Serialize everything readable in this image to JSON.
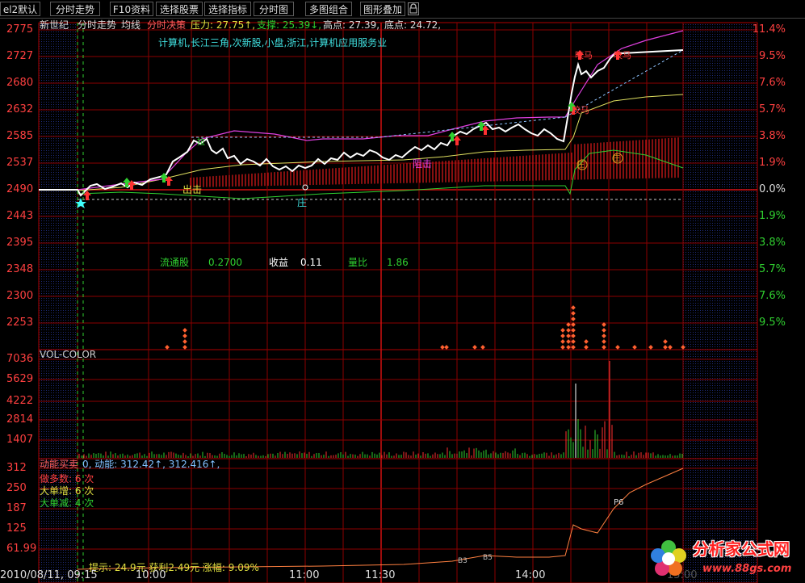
{
  "toolbar": {
    "items": [
      "el2默认",
      "分时走势",
      "F10资料",
      "选择股票",
      "选择指标",
      "分时图",
      "多图组合",
      "图形叠加"
    ]
  },
  "info": {
    "stock": "新世纪",
    "mode": "分时走势",
    "avg": "均线",
    "decision": "分时决策",
    "pressure": "压力: 27.75↑,",
    "support": "支撑: 25.39↓,",
    "high": "高点: 27.39,",
    "low": "底点: 24.72,",
    "concepts": "计算机,长江三角,次新股,小盘,浙江,计算机应用服务业"
  },
  "stats": {
    "float_label": "流通股",
    "float_value": "0.2700",
    "eps_label": "收益",
    "eps_value": "0.11",
    "vr_label": "量比",
    "vr_value": "1.86"
  },
  "signals": {
    "pull": "拉",
    "chuji": "出击",
    "zu": "阻击",
    "zhuang": "庄",
    "fuma": "咬马",
    "p6": "P6",
    "b3": "B3",
    "b5": "B5"
  },
  "price_axis": {
    "left": [
      "2775",
      "2727",
      "2680",
      "2632",
      "2585",
      "2537",
      "2490",
      "2443",
      "2395",
      "2348",
      "2300",
      "2253"
    ],
    "right": [
      "11.4%",
      "9.5%",
      "7.6%",
      "5.7%",
      "3.8%",
      "1.9%",
      "0.0%",
      "1.9%",
      "3.8%",
      "5.7%",
      "7.6%",
      "9.5%"
    ]
  },
  "vol_panel": {
    "title": "VOL-COLOR",
    "axis": [
      "7036",
      "5629",
      "4222",
      "2814",
      "1407"
    ]
  },
  "energy_panel": {
    "title": "动能买卖",
    "summary": "0, 动能: 312.42↑, 312.416↑,",
    "axis": [
      "312",
      "250",
      "187",
      "125",
      "61.99"
    ],
    "bull_count": "做多数: 6 次",
    "big_up": "大单增: 6 次",
    "big_down": "大单减: 4 次",
    "tip": "提示: 24.9元  获利2.49元  涨幅: 9.09%"
  },
  "time_axis": [
    "2010/08/11, 09:15",
    "10:00",
    "11:00",
    "11:30",
    "14:00",
    "15:00"
  ],
  "watermark": {
    "name": "分析家公式网",
    "url": "www.88gs.com"
  },
  "colors": {
    "grid": "#8b0000",
    "price": "#ffffff",
    "avg": "#e0e060",
    "up": "#ff3030",
    "down": "#30d030"
  }
}
